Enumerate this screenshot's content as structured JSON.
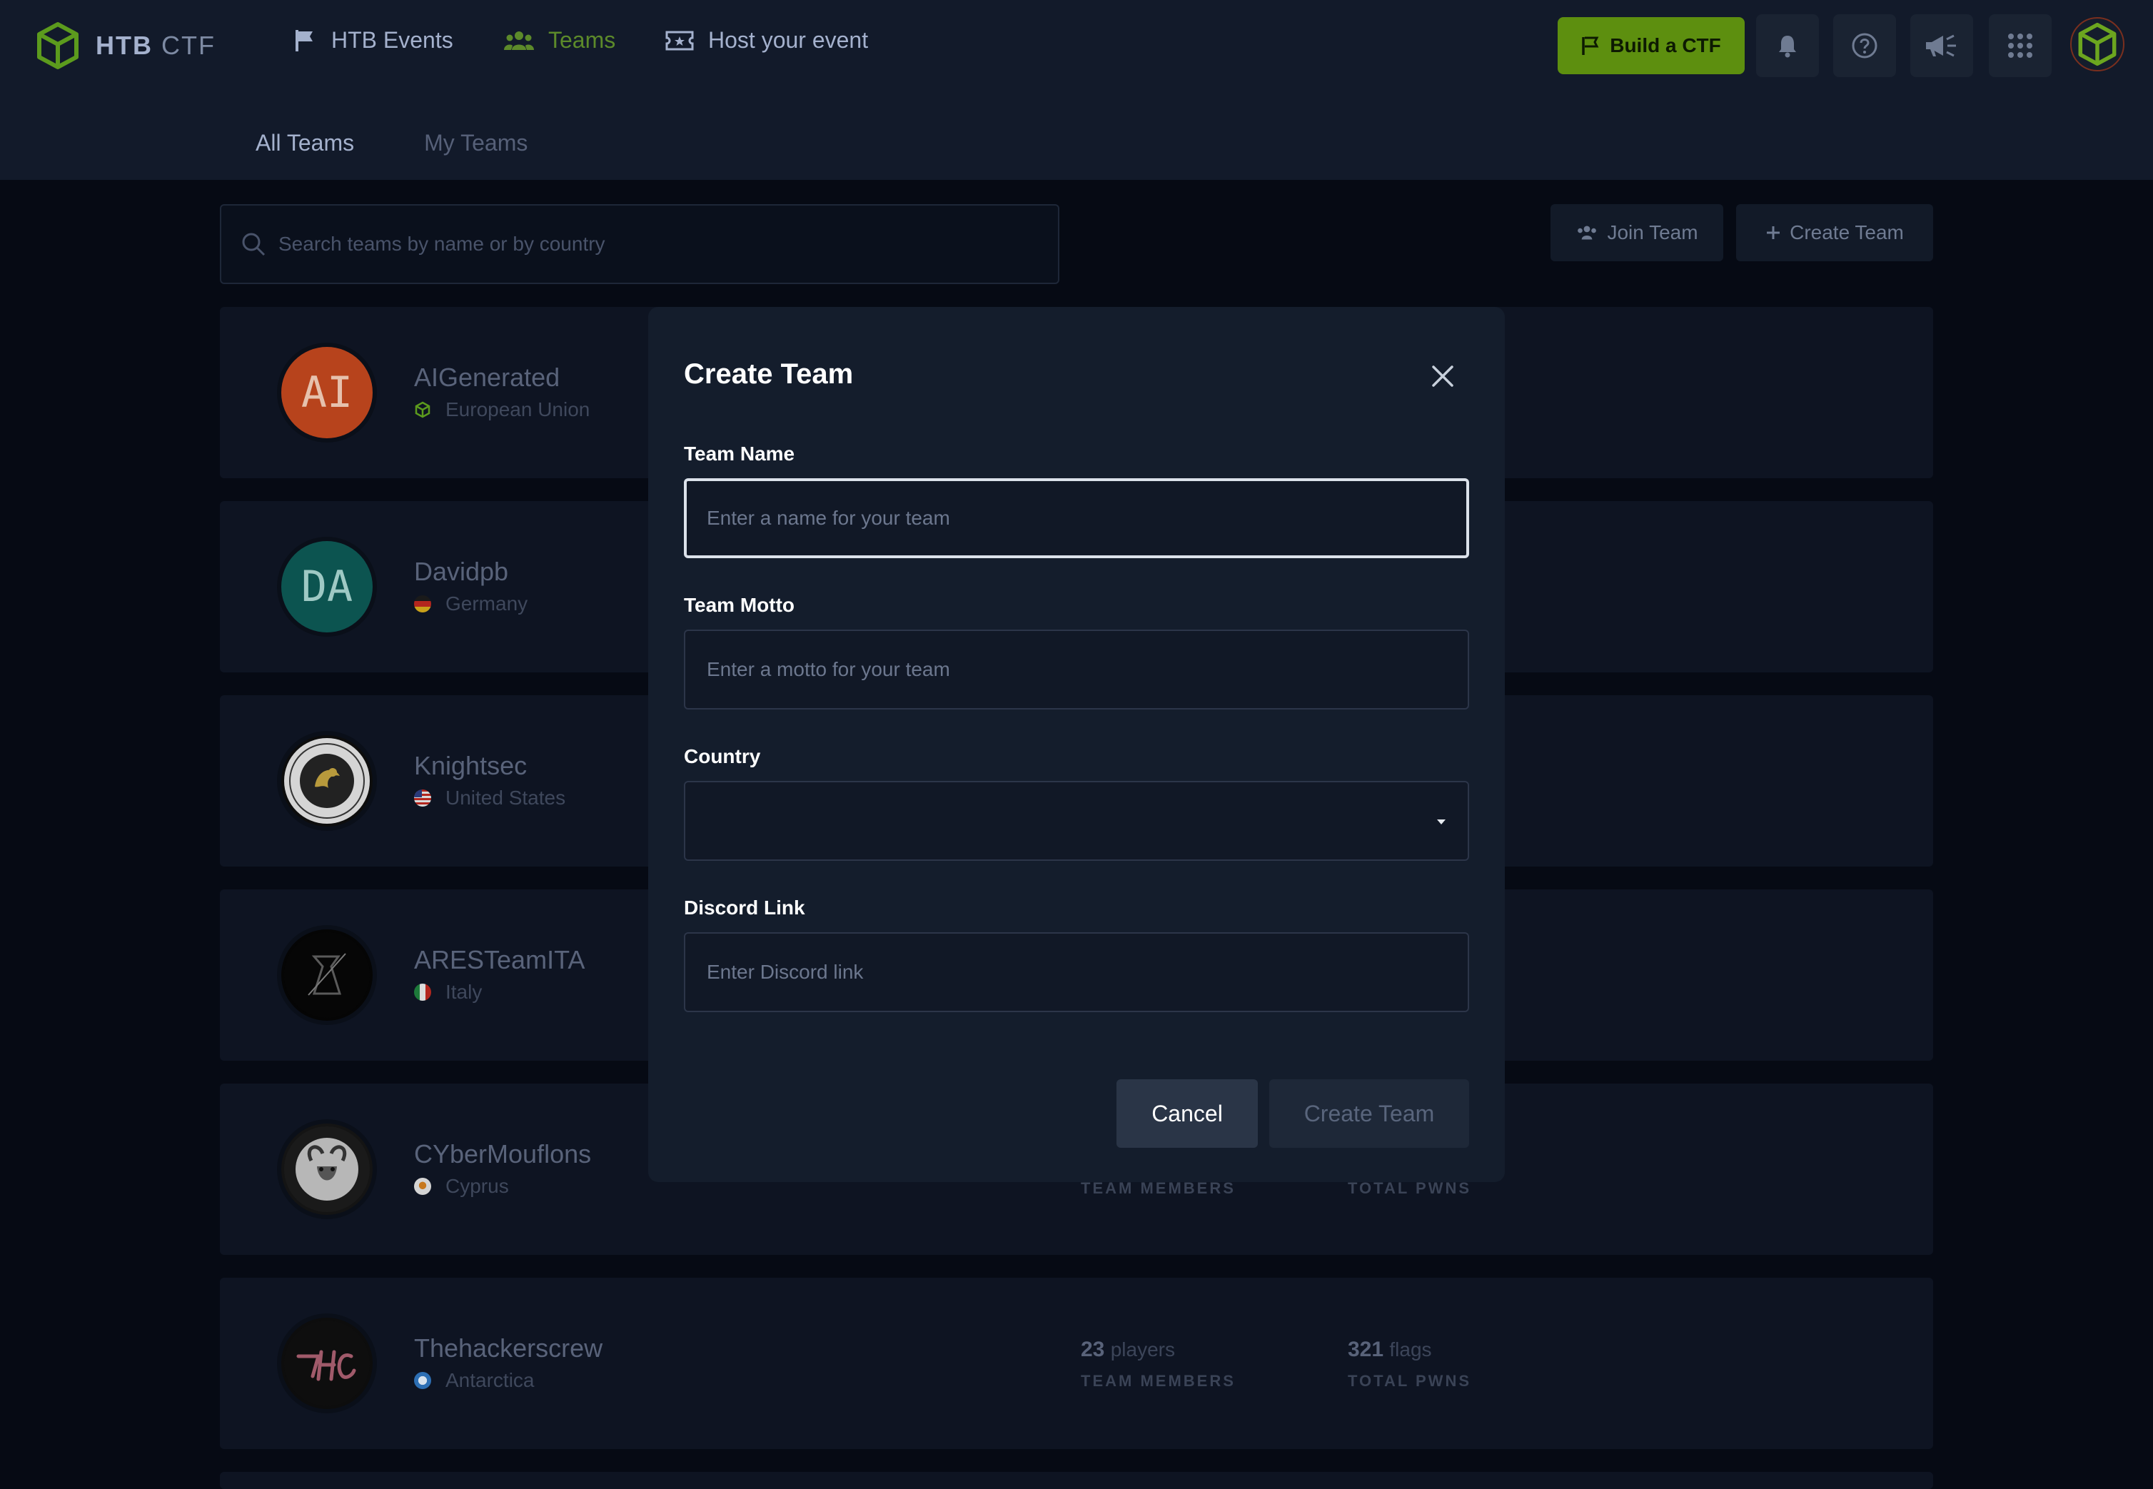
{
  "nav": {
    "logo_bold": "HTB",
    "logo_light": "CTF",
    "items": [
      {
        "label": "HTB Events",
        "icon": "flag-icon"
      },
      {
        "label": "Teams",
        "icon": "users-icon"
      },
      {
        "label": "Host your event",
        "icon": "ticket-icon"
      }
    ],
    "build_ctf": "Build a CTF",
    "accent": "#9fef00"
  },
  "tabs": [
    {
      "label": "All Teams"
    },
    {
      "label": "My Teams"
    }
  ],
  "search": {
    "placeholder": "Search teams by name or by country"
  },
  "actions": {
    "join_team": "Join Team",
    "create_team": "Create Team"
  },
  "teams": [
    {
      "initials": "AI",
      "name": "AIGenerated",
      "country": "European Union",
      "avatar_color": "#d04a1f"
    },
    {
      "initials": "DA",
      "name": "Davidpb",
      "country": "Germany",
      "avatar_color": "#0e5a56"
    },
    {
      "initials": "",
      "name": "Knightsec",
      "country": "United States"
    },
    {
      "initials": "",
      "name": "ARESTeamITA",
      "country": "Italy"
    },
    {
      "initials": "",
      "name": "CYberMouflons",
      "country": "Cyprus",
      "members_label": "TEAM MEMBERS",
      "pwns_label": "TOTAL PWNS"
    },
    {
      "initials": "",
      "name": "Thehackerscrew",
      "country": "Antarctica",
      "members_value": "23",
      "members_unit": "players",
      "members_label": "TEAM MEMBERS",
      "pwns_value": "321",
      "pwns_unit": "flags",
      "pwns_label": "TOTAL PWNS"
    }
  ],
  "modal": {
    "title": "Create Team",
    "team_name_label": "Team Name",
    "team_name_placeholder": "Enter a name for your team",
    "team_motto_label": "Team Motto",
    "team_motto_placeholder": "Enter a motto for your team",
    "country_label": "Country",
    "country_value": "",
    "discord_label": "Discord Link",
    "discord_placeholder": "Enter Discord link",
    "cancel": "Cancel",
    "create": "Create Team"
  }
}
